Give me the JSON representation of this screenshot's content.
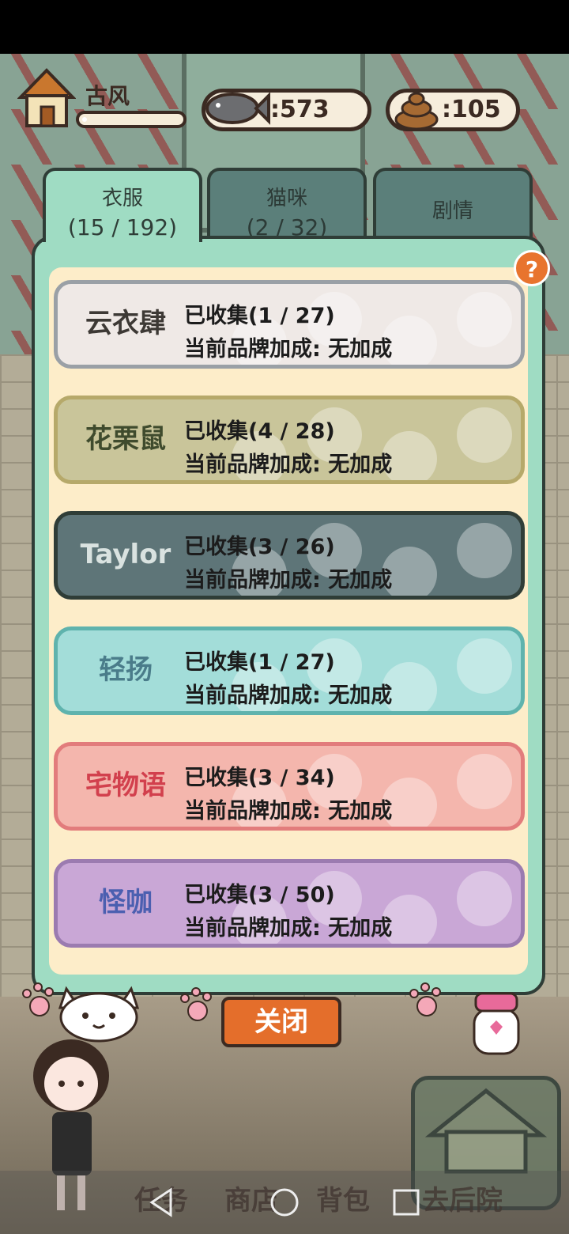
{
  "hud": {
    "player_name": "古风",
    "xp_fraction": 0.05,
    "fish_count": ":573",
    "poop_count": ":105"
  },
  "tabs": [
    {
      "label": "衣服",
      "count": "(15 / 192)",
      "active": true
    },
    {
      "label": "猫咪",
      "count": "(2 / 32)",
      "active": false
    },
    {
      "label": "剧情",
      "count": "",
      "active": false
    }
  ],
  "help_label": "?",
  "brands": [
    {
      "logo": "云衣肆",
      "collected": "已收集(1 / 27)",
      "bonus": "当前品牌加成: 无加成",
      "bg": "#efe9e6",
      "border": "#9aa0a6",
      "logo_color": "#3d3935"
    },
    {
      "logo": "花栗鼠",
      "collected": "已收集(4 / 28)",
      "bonus": "当前品牌加成: 无加成",
      "bg": "#c9c59a",
      "border": "#b6a96a",
      "logo_color": "#3f4b2d"
    },
    {
      "logo": "Taylor",
      "collected": "已收集(3 / 26)",
      "bonus": "当前品牌加成: 无加成",
      "bg": "#5e7578",
      "border": "#2f3d37",
      "logo_color": "#d9e2e0"
    },
    {
      "logo": "轻扬",
      "collected": "已收集(1 / 27)",
      "bonus": "当前品牌加成: 无加成",
      "bg": "#a3ddd9",
      "border": "#5fb3ad",
      "logo_color": "#4a7c8a"
    },
    {
      "logo": "宅物语",
      "collected": "已收集(3 / 34)",
      "bonus": "当前品牌加成: 无加成",
      "bg": "#f4b6ad",
      "border": "#e27c7c",
      "logo_color": "#d2404d"
    },
    {
      "logo": "怪咖",
      "collected": "已收集(3 / 50)",
      "bonus": "当前品牌加成: 无加成",
      "bg": "#c9a7d6",
      "border": "#9b7bb0",
      "logo_color": "#4b5fb0"
    }
  ],
  "close_label": "关闭",
  "bottom_nav": {
    "task": "任务",
    "shop": "商店",
    "bag": "背包",
    "backyard": "去后院"
  }
}
